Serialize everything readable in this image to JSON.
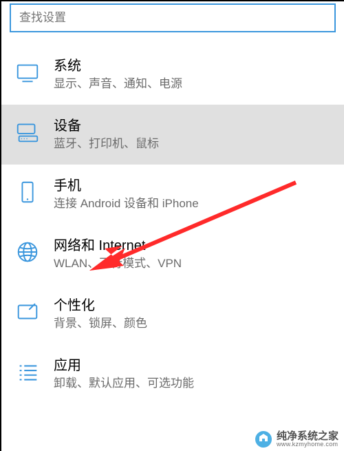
{
  "search": {
    "placeholder": "查找设置"
  },
  "items": [
    {
      "key": "system",
      "title": "系统",
      "sub": "显示、声音、通知、电源"
    },
    {
      "key": "devices",
      "title": "设备",
      "sub": "蓝牙、打印机、鼠标"
    },
    {
      "key": "phone",
      "title": "手机",
      "sub": "连接 Android 设备和 iPhone"
    },
    {
      "key": "network",
      "title": "网络和 Internet",
      "sub": "WLAN、飞行模式、VPN"
    },
    {
      "key": "personalization",
      "title": "个性化",
      "sub": "背景、锁屏、颜色"
    },
    {
      "key": "apps",
      "title": "应用",
      "sub": "卸载、默认应用、可选功能"
    }
  ],
  "watermark": {
    "main": "纯净系统之家",
    "sub": "www.kzmyhome.com"
  },
  "colors": {
    "accent": "#3a96dd",
    "selectedBg": "#e0e0e0",
    "iconBlue": "#3a96dd",
    "arrow": "#ff2a2a"
  }
}
